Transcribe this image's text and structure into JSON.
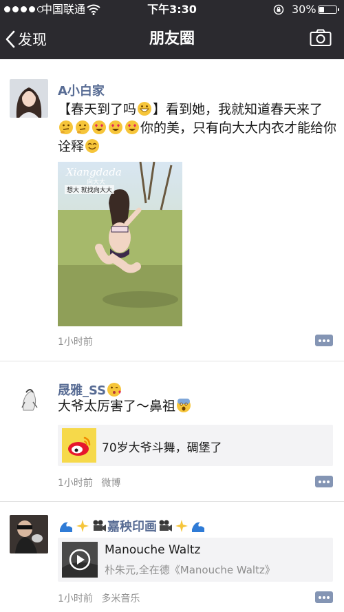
{
  "status_bar": {
    "carrier": "中国联通",
    "time": "下午3:30",
    "battery": "30%",
    "battery_level": 0.3,
    "signal_filled": 4,
    "signal_total": 5
  },
  "nav": {
    "back_label": "发现",
    "title": "朋友圈"
  },
  "colors": {
    "nav_bg": "#2b2a2f",
    "name_link": "#586c94",
    "meta_gray": "#8e8e8e",
    "comment_icon": "#8495b4",
    "share_bg": "#f3f3f5"
  },
  "posts": [
    {
      "author": "A小白家",
      "text_1": "【春天到了吗",
      "text_2": "】看到她，我就知道春天来了",
      "text_3": "你的美，只有向大大内衣才能给你诠释",
      "image_caption_1": "Xiangdada",
      "image_caption_2": "向大大",
      "image_caption_3": "想大 就找向大大",
      "time": "1小时前"
    },
    {
      "author": "晟雅_SS",
      "text_1": "大爷太厉害了～鼻祖",
      "share_title": "70岁大爷斗舞，碉堡了",
      "time": "1小时前",
      "source": "微博"
    },
    {
      "author": "嘉秧印画",
      "share_title": "Manouche Waltz",
      "share_subtitle": "朴朱元,全在德《Manouche Waltz》",
      "time": "1小时前",
      "source": "多米音乐"
    }
  ]
}
